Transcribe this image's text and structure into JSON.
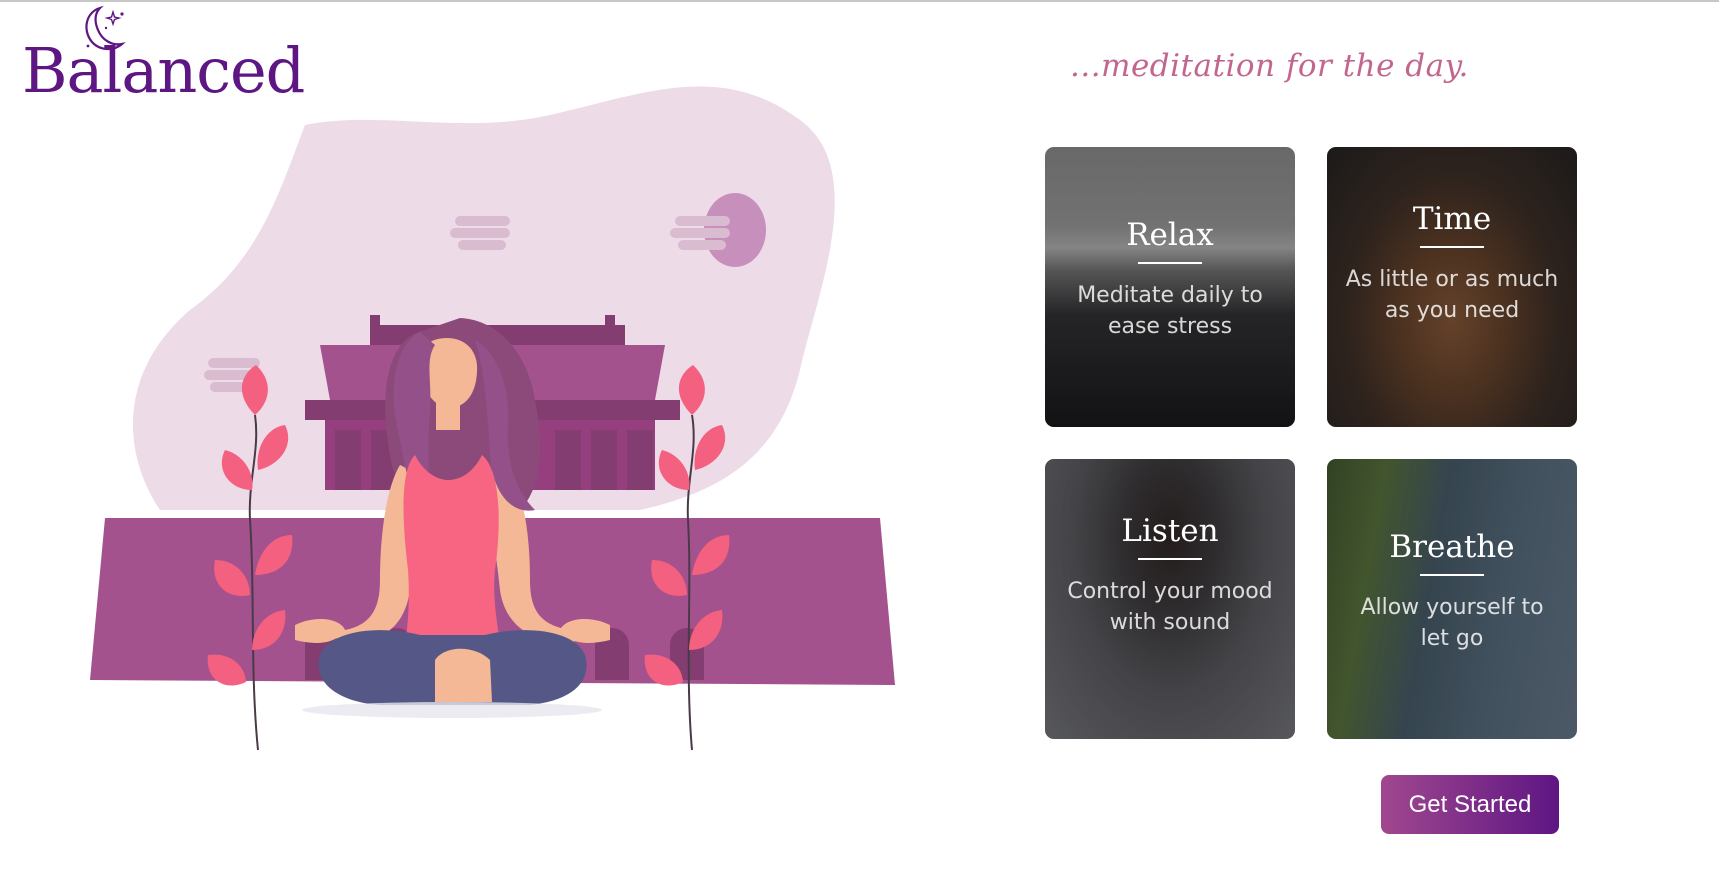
{
  "brand": {
    "name": "Balanced"
  },
  "tagline": "...meditation for the day.",
  "cards": [
    {
      "title": "Relax",
      "text": "Meditate daily to ease stress"
    },
    {
      "title": "Time",
      "text": "As little or as much as you need"
    },
    {
      "title": "Listen",
      "text": "Control your mood with sound"
    },
    {
      "title": "Breathe",
      "text": "Allow yourself to let go"
    }
  ],
  "cta": {
    "label": "Get Started"
  },
  "icons": {
    "logo": "crescent-moon-stars-icon",
    "illustration": "meditating-woman-temple-illustration"
  },
  "colors": {
    "brand_purple": "#5e1683",
    "tagline_pink": "#c3668f",
    "button_gradient_start": "#a0478f",
    "button_gradient_end": "#5e1683",
    "blob_lilac": "#eddbe7",
    "temple_mauve": "#a4528d",
    "leaf_coral": "#f4607f"
  }
}
